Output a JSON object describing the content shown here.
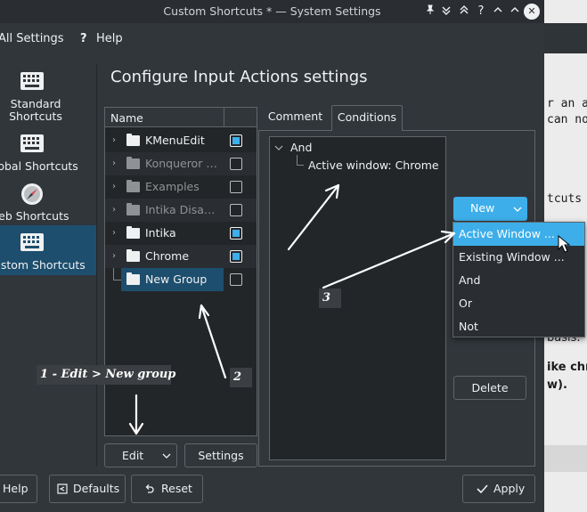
{
  "window": {
    "title": "Custom Shortcuts * — System Settings",
    "titlebar_icons": [
      "pin-icon",
      "keep-below-icon",
      "keep-above-icon",
      "help-icon",
      "minimize-icon",
      "close-icon"
    ]
  },
  "toolbar": {
    "all_settings": "All Settings",
    "help": "Help"
  },
  "sidebar": {
    "items": [
      {
        "label_line1": "Standard",
        "label_line2": "Shortcuts"
      },
      {
        "label_line1": "Global Shortcuts",
        "label_line2": ""
      },
      {
        "label_line1": "Web Shortcuts",
        "label_line2": ""
      },
      {
        "label_line1": "Custom Shortcuts",
        "label_line2": ""
      }
    ],
    "active_index": 3
  },
  "main": {
    "heading": "Configure Input Actions settings",
    "tree": {
      "header": "Name",
      "rows": [
        {
          "label": "KMenuEdit",
          "enabled": true,
          "dim": false
        },
        {
          "label": "Konqueror Gestures",
          "enabled": false,
          "dim": true
        },
        {
          "label": "Examples",
          "enabled": false,
          "dim": true
        },
        {
          "label": "Intika Disabled",
          "enabled": false,
          "dim": true
        },
        {
          "label": "Intika",
          "enabled": true,
          "dim": false
        },
        {
          "label": "Chrome",
          "enabled": true,
          "dim": false
        },
        {
          "label": "New Group",
          "enabled": false,
          "dim": false,
          "selected": true
        }
      ]
    },
    "edit_button": "Edit",
    "settings_button": "Settings",
    "tabs": [
      {
        "label": "Comment",
        "active": false
      },
      {
        "label": "Conditions",
        "active": true
      }
    ],
    "conditions": {
      "root": "And",
      "child": "Active window: Chrome"
    },
    "new_button": "New",
    "delete_button": "Delete",
    "new_menu": [
      {
        "label": "Active Window ...",
        "highlighted": true
      },
      {
        "label": "Existing Window ...",
        "highlighted": false
      },
      {
        "label": "And",
        "highlighted": false
      },
      {
        "label": "Or",
        "highlighted": false
      },
      {
        "label": "Not",
        "highlighted": false
      }
    ]
  },
  "bottom": {
    "help": "Help",
    "defaults": "Defaults",
    "reset": "Reset",
    "apply": "Apply"
  },
  "annotations": {
    "a1": "1 - Edit > New group",
    "a2": "2",
    "a3": "3"
  },
  "background_text": {
    "line1": "r an a",
    "line2": "can no",
    "line3": "tcuts",
    "line4": "basis.",
    "line5": "ike chr",
    "line6": "w)."
  },
  "colors": {
    "accent": "#3daee9",
    "window_bg": "#31363b",
    "view_bg": "#232629",
    "selection": "#1d4e6e"
  }
}
